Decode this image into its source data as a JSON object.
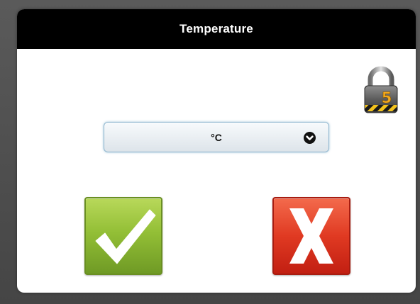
{
  "dialog": {
    "title": "Temperature"
  },
  "lock": {
    "level": "5",
    "icon": "padlock-icon"
  },
  "unit_select": {
    "selected": "°C",
    "icon": "chevron-down-icon"
  },
  "buttons": {
    "confirm_icon": "checkmark-icon",
    "cancel_icon": "x-icon"
  },
  "colors": {
    "titlebar": "#000000",
    "confirm": "#93bf36",
    "cancel": "#e03a22",
    "lock_number": "#f2a81d"
  }
}
